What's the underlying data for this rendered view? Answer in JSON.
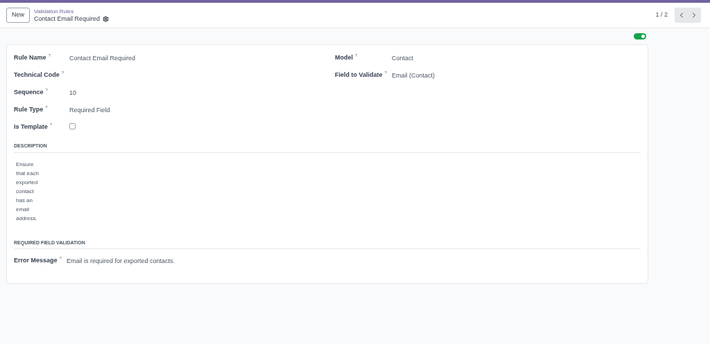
{
  "header": {
    "new_button": "New",
    "breadcrumb": "Validation Rules",
    "record_title": "Contact Email Required",
    "pager": "1 / 2"
  },
  "active_toggle": {
    "on": true
  },
  "left_fields": [
    {
      "label": "Rule Name",
      "help": "?",
      "kind": "text",
      "value": "Contact Email Required"
    },
    {
      "label": "Technical Code",
      "help": "?",
      "kind": "text"
    },
    {
      "label": "Sequence",
      "help": "?",
      "kind": "text",
      "value": "10"
    },
    {
      "label": "Rule Type",
      "help": "?",
      "kind": "text",
      "value": "Required Field"
    },
    {
      "label": "Is Template",
      "help": "?",
      "kind": "checkbox",
      "checked": false
    }
  ],
  "right_fields": [
    {
      "label": "Model",
      "help": "?",
      "kind": "text",
      "value": "Contact"
    },
    {
      "label": "Field to Validate",
      "help": "?",
      "kind": "text",
      "value": "Email (Contact)"
    }
  ],
  "description": {
    "heading": "DESCRIPTION",
    "text": "Ensure that each exported contact has an email address."
  },
  "validation": {
    "heading": "REQUIRED FIELD VALIDATION",
    "field": {
      "label": "Error Message",
      "help": "?",
      "value": "Email is required for exported contacts."
    }
  }
}
